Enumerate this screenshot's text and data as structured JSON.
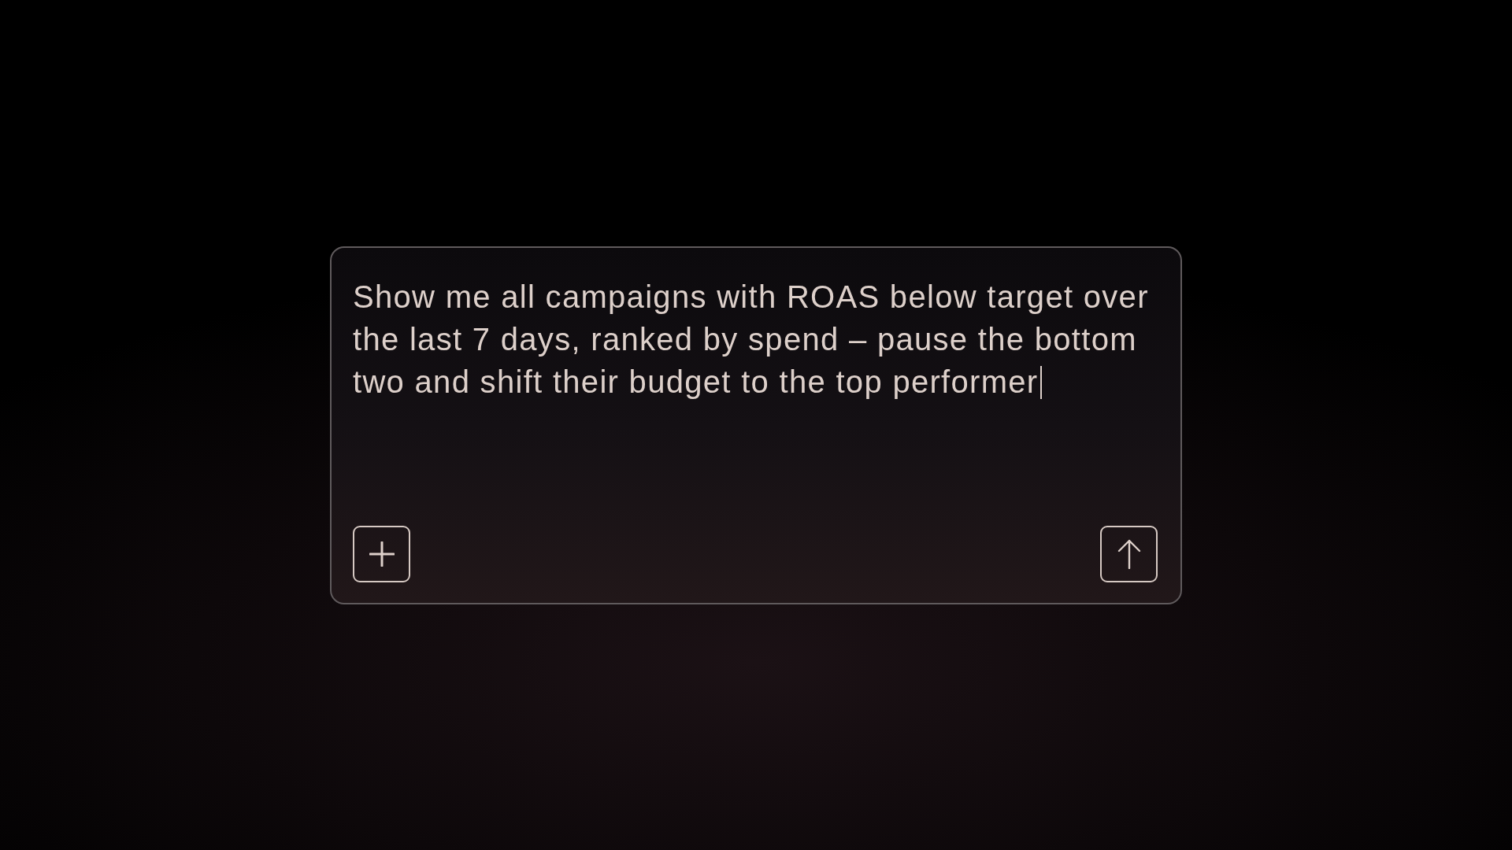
{
  "composer": {
    "value": "Show me all campaigns with ROAS below target over the last 7 days, ranked by spend – pause the bottom two and shift their budget to the top performer",
    "focused": true
  }
}
